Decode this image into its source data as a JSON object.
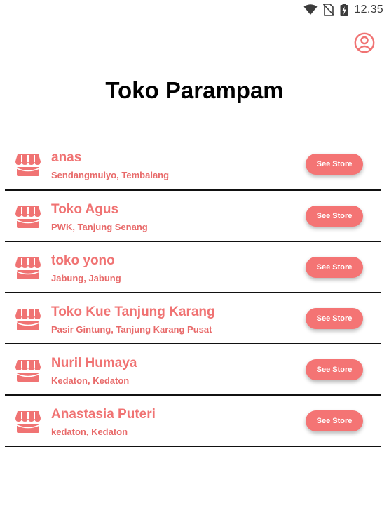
{
  "status_bar": {
    "time": "12.35",
    "icons": [
      "wifi-icon",
      "no-sim-icon",
      "battery-charging-icon"
    ]
  },
  "header": {
    "title": "Toko Parampam",
    "profile_icon": "account-circle-icon"
  },
  "colors": {
    "accent": "#f47474",
    "text_accent": "#f07373",
    "divider": "#111111"
  },
  "stores": [
    {
      "name": "anas",
      "address": "Sendangmulyo, Tembalang",
      "button_label": "See Store",
      "icon": "storefront-icon"
    },
    {
      "name": "Toko Agus",
      "address": "PWK, Tanjung Senang",
      "button_label": "See Store",
      "icon": "storefront-icon"
    },
    {
      "name": "toko yono",
      "address": "Jabung, Jabung",
      "button_label": "See Store",
      "icon": "storefront-icon"
    },
    {
      "name": "Toko Kue Tanjung Karang",
      "address": "Pasir Gintung, Tanjung Karang Pusat",
      "button_label": "See Store",
      "icon": "storefront-icon"
    },
    {
      "name": "Nuril Humaya",
      "address": "Kedaton, Kedaton",
      "button_label": "See Store",
      "icon": "storefront-icon"
    },
    {
      "name": "Anastasia Puteri",
      "address": "kedaton, Kedaton",
      "button_label": "See Store",
      "icon": "storefront-icon"
    }
  ]
}
